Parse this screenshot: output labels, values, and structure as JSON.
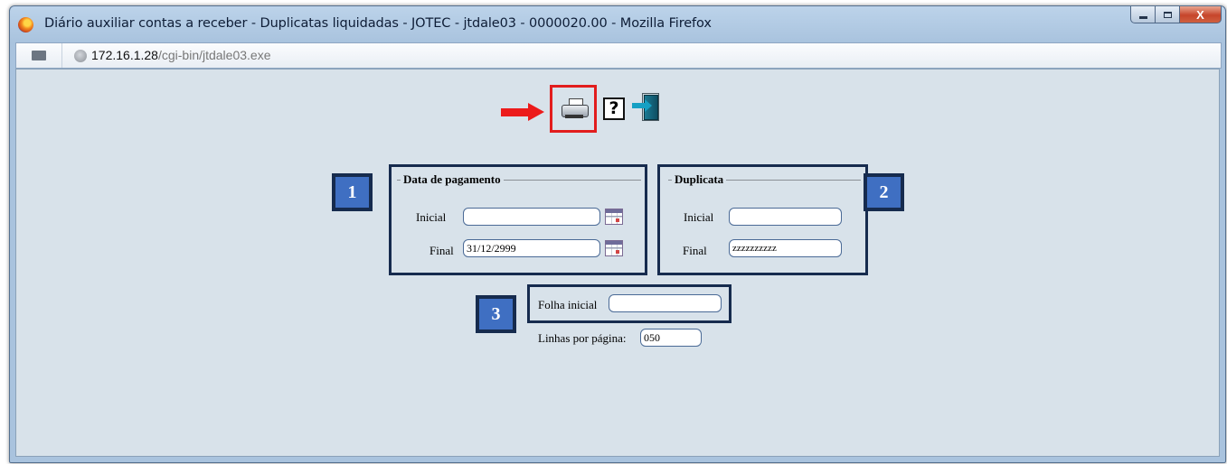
{
  "window": {
    "title": "Diário auxiliar contas a receber - Duplicatas liquidadas - JOTEC - jtdale03 - 0000020.00 - Mozilla Firefox",
    "min_icon": "minimize-icon",
    "max_icon": "maximize-icon",
    "close_label": "X"
  },
  "address": {
    "host": "172.16.1.28",
    "path": "/cgi-bin/jtdale03.exe"
  },
  "toolbar": {
    "help_label": "?",
    "print_icon": "printer-icon",
    "exit_icon": "exit-door-icon",
    "highlight_color": "#e21d1d"
  },
  "badges": {
    "one": "1",
    "two": "2",
    "three": "3",
    "color": "#3f6fc2",
    "border_color": "#162b4e"
  },
  "data_pagamento": {
    "legend": "Data de pagamento",
    "inicial_label": "Inicial",
    "inicial_value": "",
    "final_label": "Final",
    "final_value": "31/12/2999",
    "calendar_icon": "calendar-icon"
  },
  "duplicata": {
    "legend": "Duplicata",
    "inicial_label": "Inicial",
    "inicial_value": "",
    "final_label": "Final",
    "final_value": "zzzzzzzzzz"
  },
  "folha": {
    "folha_inicial_label": "Folha inicial",
    "folha_inicial_value": "",
    "linhas_label": "Linhas por página:",
    "linhas_value": "050"
  }
}
